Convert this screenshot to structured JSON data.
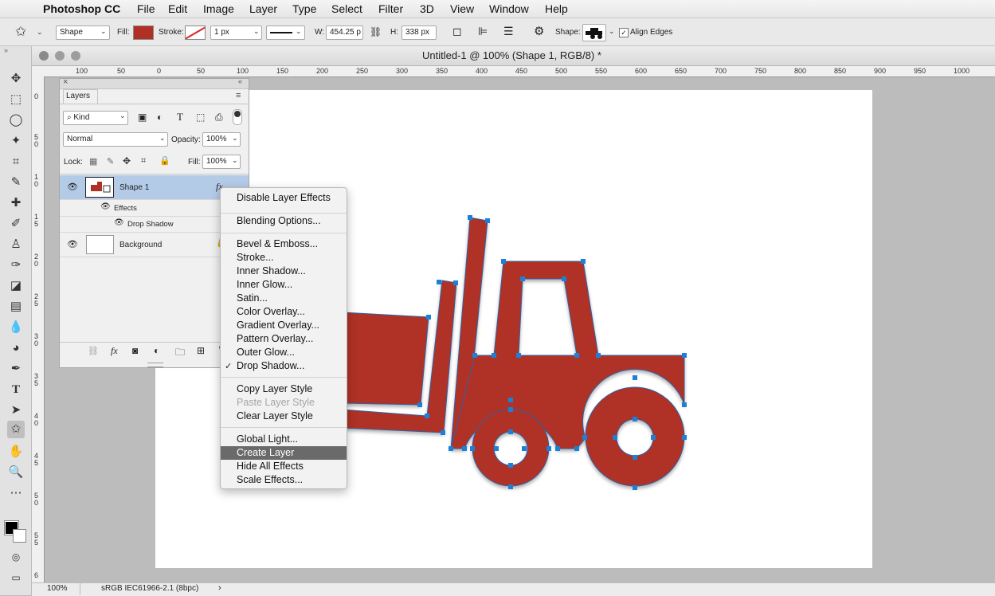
{
  "menubar": {
    "app": "Photoshop CC",
    "items": [
      "File",
      "Edit",
      "Image",
      "Layer",
      "Type",
      "Select",
      "Filter",
      "3D",
      "View",
      "Window",
      "Help"
    ]
  },
  "options": {
    "mode": "Shape",
    "fill_label": "Fill:",
    "fill_color": "#b03025",
    "stroke_label": "Stroke:",
    "stroke_width": "1 px",
    "w_label": "W:",
    "w_value": "454.25 p",
    "h_label": "H:",
    "h_value": "338 px",
    "shape_label": "Shape:",
    "align_edges": "Align Edges"
  },
  "document": {
    "title": "Untitled-1 @ 100% (Shape 1, RGB/8) *",
    "zoom": "100%",
    "profile": "sRGB IEC61966-2.1 (8bpc)"
  },
  "ruler": {
    "h_labels": [
      "100",
      "50",
      "0",
      "50",
      "100",
      "150",
      "200",
      "250",
      "300",
      "350",
      "400",
      "450",
      "500",
      "550",
      "600",
      "650",
      "700",
      "750",
      "800",
      "850",
      "900",
      "950",
      "1000"
    ],
    "v_labels": [
      "0",
      "5",
      "0",
      "1",
      "0",
      "1",
      "5",
      "2",
      "0",
      "2",
      "5",
      "3",
      "0",
      "3",
      "5",
      "4",
      "0",
      "4",
      "5",
      "5",
      "0",
      "5",
      "5",
      "6"
    ]
  },
  "layers_panel": {
    "tab": "Layers",
    "filter_kind": "Kind",
    "blend_mode": "Normal",
    "opacity_label": "Opacity:",
    "opacity": "100%",
    "lock_label": "Lock:",
    "fill_label": "Fill:",
    "fill": "100%",
    "layers": [
      {
        "name": "Shape 1",
        "selected": true,
        "effects_label": "Effects",
        "effect": "Drop Shadow"
      },
      {
        "name": "Background",
        "selected": false
      }
    ]
  },
  "context_menu": {
    "items": [
      {
        "label": "Disable Layer Effects"
      },
      {
        "label": "Blending Options..."
      },
      {
        "label": "Bevel & Emboss..."
      },
      {
        "label": "Stroke..."
      },
      {
        "label": "Inner Shadow..."
      },
      {
        "label": "Inner Glow..."
      },
      {
        "label": "Satin..."
      },
      {
        "label": "Color Overlay..."
      },
      {
        "label": "Gradient Overlay..."
      },
      {
        "label": "Pattern Overlay..."
      },
      {
        "label": "Outer Glow..."
      },
      {
        "label": "Drop Shadow...",
        "checked": true
      },
      {
        "label": "Copy Layer Style"
      },
      {
        "label": "Paste Layer Style",
        "disabled": true
      },
      {
        "label": "Clear Layer Style"
      },
      {
        "label": "Global Light..."
      },
      {
        "label": "Create Layer",
        "highlighted": true
      },
      {
        "label": "Hide All Effects"
      },
      {
        "label": "Scale Effects..."
      }
    ]
  },
  "colors": {
    "shape_fill": "#b03025",
    "anchor": "#1e7fd6",
    "selection": "#b4cbe8",
    "menu_highlight": "#6a6a6a"
  }
}
